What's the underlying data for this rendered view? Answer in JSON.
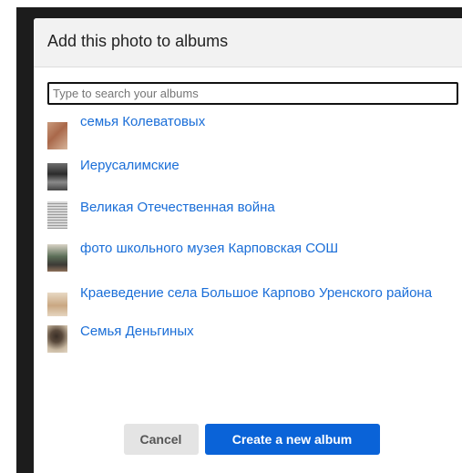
{
  "dialog": {
    "title": "Add this photo to albums",
    "search_placeholder": "Type to search your albums",
    "cancel_label": "Cancel",
    "create_label": "Create a new album",
    "accent_color": "#0a63d8",
    "link_color": "#1a6ed8"
  },
  "albums": [
    {
      "label": "семья Колеватовых",
      "thumb": "reddish-brown document photo"
    },
    {
      "label": "Иерусалимские",
      "thumb": "dark group photo"
    },
    {
      "label": "Великая Отечественная война",
      "thumb": "gray text document"
    },
    {
      "label": "фото школьного музея Карповская СОШ",
      "thumb": "museum room photo"
    },
    {
      "label": "Краеведение села Большое Карпово Уренского района",
      "thumb": "beige paper photo"
    },
    {
      "label": "Семья Деньгиных",
      "thumb": "sepia portrait photo"
    }
  ]
}
